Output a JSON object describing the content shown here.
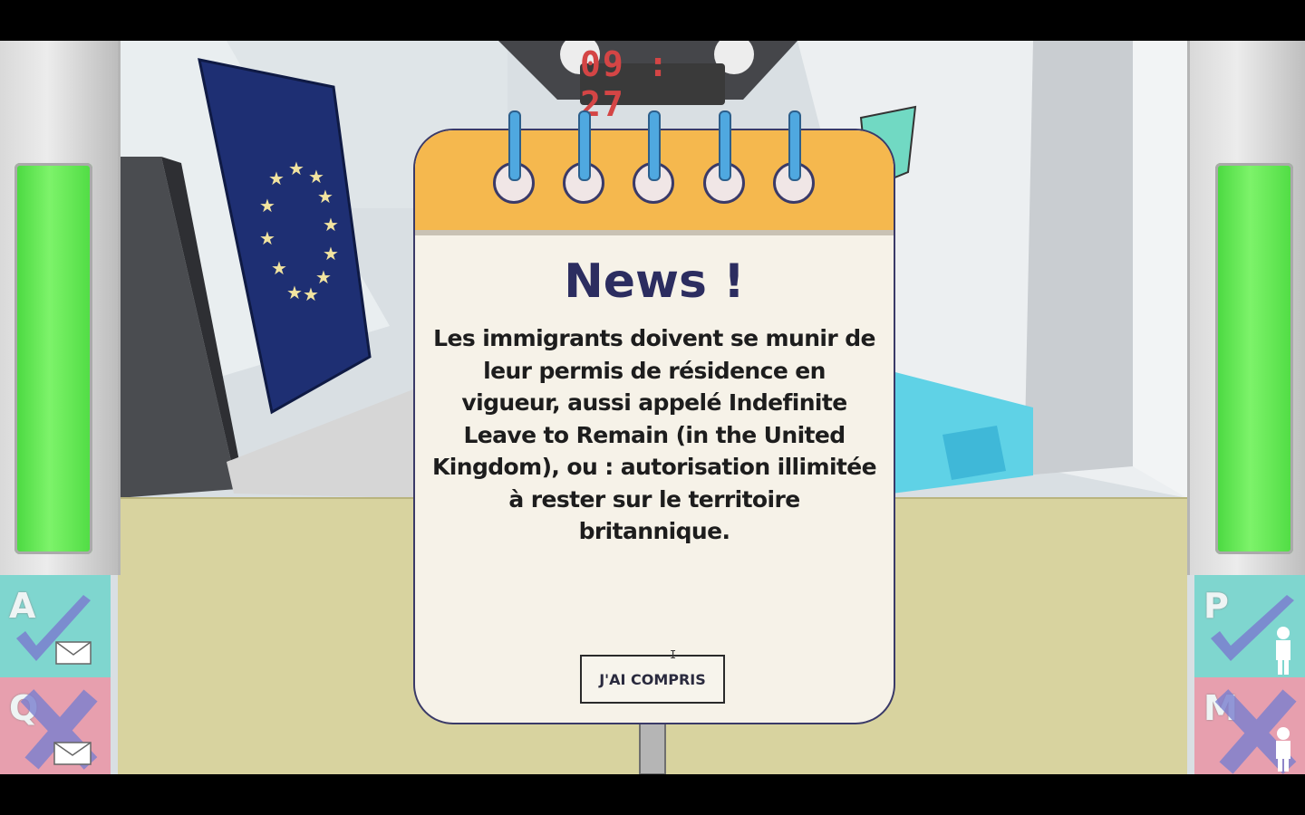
{
  "hud": {
    "clock": "09 : 27"
  },
  "left_panel": {
    "approve_key": "A",
    "reject_key": "Q"
  },
  "right_panel": {
    "approve_key": "P",
    "reject_key": "M"
  },
  "news": {
    "title": "News !",
    "body": "Les immigrants doivent se munir de leur permis de résidence en vigueur, aussi appelé Indefinite Leave to Remain (in the United Kingdom), ou : autorisation illimitée à rester sur le territoire britannique.",
    "button": "J'AI COMPRIS"
  },
  "icons": [
    "check-icon",
    "envelope-icon",
    "cross-icon",
    "person-icon",
    "eu-flag-icon"
  ],
  "colors": {
    "gauge": "#5be34a",
    "notepad_header": "#f5b84e",
    "title": "#2c2d60",
    "clock_digits": "#d44545",
    "approve_key": "#7fd6cf",
    "reject_key": "#e79fae"
  }
}
